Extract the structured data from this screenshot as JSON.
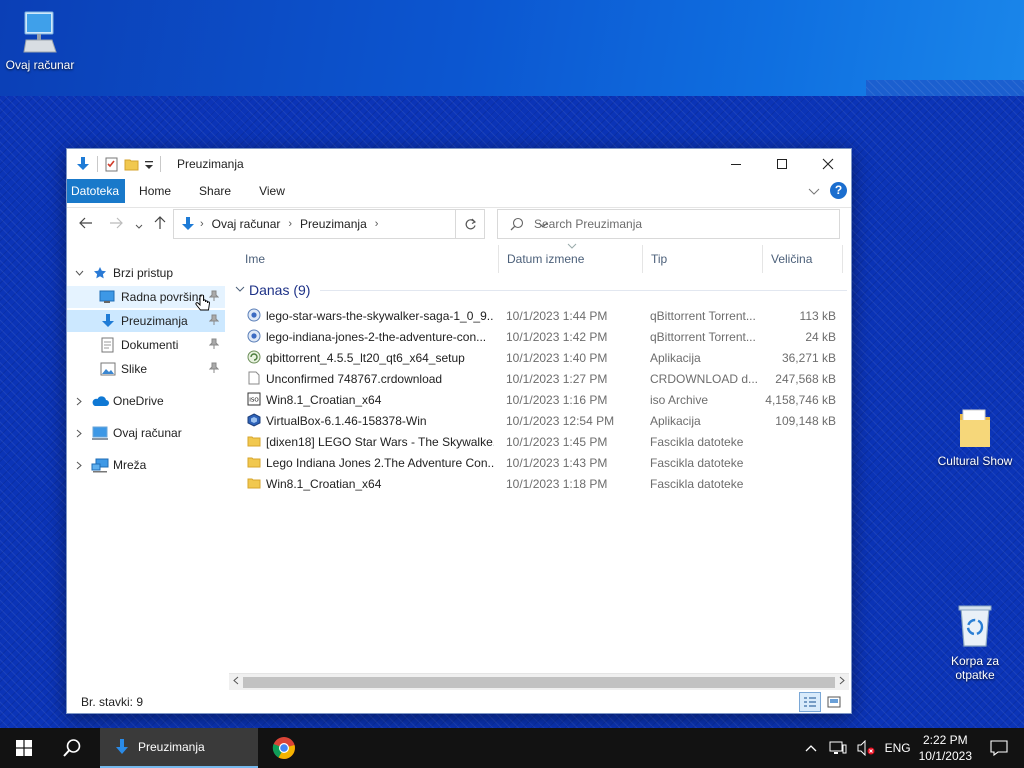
{
  "desktop": {
    "icons": {
      "this_pc": "Ovaj računar",
      "cultural_show": "Cultural Show",
      "recycle_bin_line1": "Korpa za",
      "recycle_bin_line2": "otpatke"
    }
  },
  "window": {
    "title": "Preuzimanja",
    "ribbon_tabs": {
      "file": "Datoteka",
      "home": "Home",
      "share": "Share",
      "view": "View"
    },
    "help": "?",
    "address": {
      "root": "Ovaj računar",
      "current": "Preuzimanja"
    },
    "search_placeholder": "Search Preuzimanja",
    "nav": {
      "quick_access": "Brzi pristup",
      "desktop": "Radna površina",
      "downloads": "Preuzimanja",
      "documents": "Dokumenti",
      "pictures": "Slike",
      "onedrive": "OneDrive",
      "this_pc": "Ovaj računar",
      "network": "Mreža"
    },
    "columns": {
      "name": "Ime",
      "date": "Datum izmene",
      "type": "Tip",
      "size": "Veličina"
    },
    "group_label": "Danas (9)",
    "files": [
      {
        "name": "lego-star-wars-the-skywalker-saga-1_0_9...",
        "date": "10/1/2023 1:44 PM",
        "type": "qBittorrent Torrent...",
        "size": "113 kB",
        "icon": "torrent-icon"
      },
      {
        "name": "lego-indiana-jones-2-the-adventure-con...",
        "date": "10/1/2023 1:42 PM",
        "type": "qBittorrent Torrent...",
        "size": "24 kB",
        "icon": "torrent-icon"
      },
      {
        "name": "qbittorrent_4.5.5_lt20_qt6_x64_setup",
        "date": "10/1/2023 1:40 PM",
        "type": "Aplikacija",
        "size": "36,271 kB",
        "icon": "installer-icon"
      },
      {
        "name": "Unconfirmed 748767.crdownload",
        "date": "10/1/2023 1:27 PM",
        "type": "CRDOWNLOAD d...",
        "size": "247,568 kB",
        "icon": "file-icon"
      },
      {
        "name": "Win8.1_Croatian_x64",
        "date": "10/1/2023 1:16 PM",
        "type": "iso Archive",
        "size": "4,158,746 kB",
        "icon": "iso-icon"
      },
      {
        "name": "VirtualBox-6.1.46-158378-Win",
        "date": "10/1/2023 12:54 PM",
        "type": "Aplikacija",
        "size": "109,148 kB",
        "icon": "virtualbox-icon"
      },
      {
        "name": "[dixen18] LEGO Star Wars - The Skywalke...",
        "date": "10/1/2023 1:45 PM",
        "type": "Fascikla datoteke",
        "size": "",
        "icon": "folder-icon"
      },
      {
        "name": "Lego Indiana Jones 2.The Adventure Con...",
        "date": "10/1/2023 1:43 PM",
        "type": "Fascikla datoteke",
        "size": "",
        "icon": "folder-icon"
      },
      {
        "name": "Win8.1_Croatian_x64",
        "date": "10/1/2023 1:18 PM",
        "type": "Fascikla datoteke",
        "size": "",
        "icon": "folder-icon"
      }
    ],
    "status": "Br. stavki: 9"
  },
  "taskbar": {
    "app_label": "Preuzimanja",
    "lang": "ENG",
    "time": "2:22 PM",
    "date": "10/1/2023"
  },
  "colors": {
    "accent": "#1979ca",
    "selection": "#cce8ff",
    "hover": "#e5f3ff",
    "taskbar": "#121212"
  }
}
